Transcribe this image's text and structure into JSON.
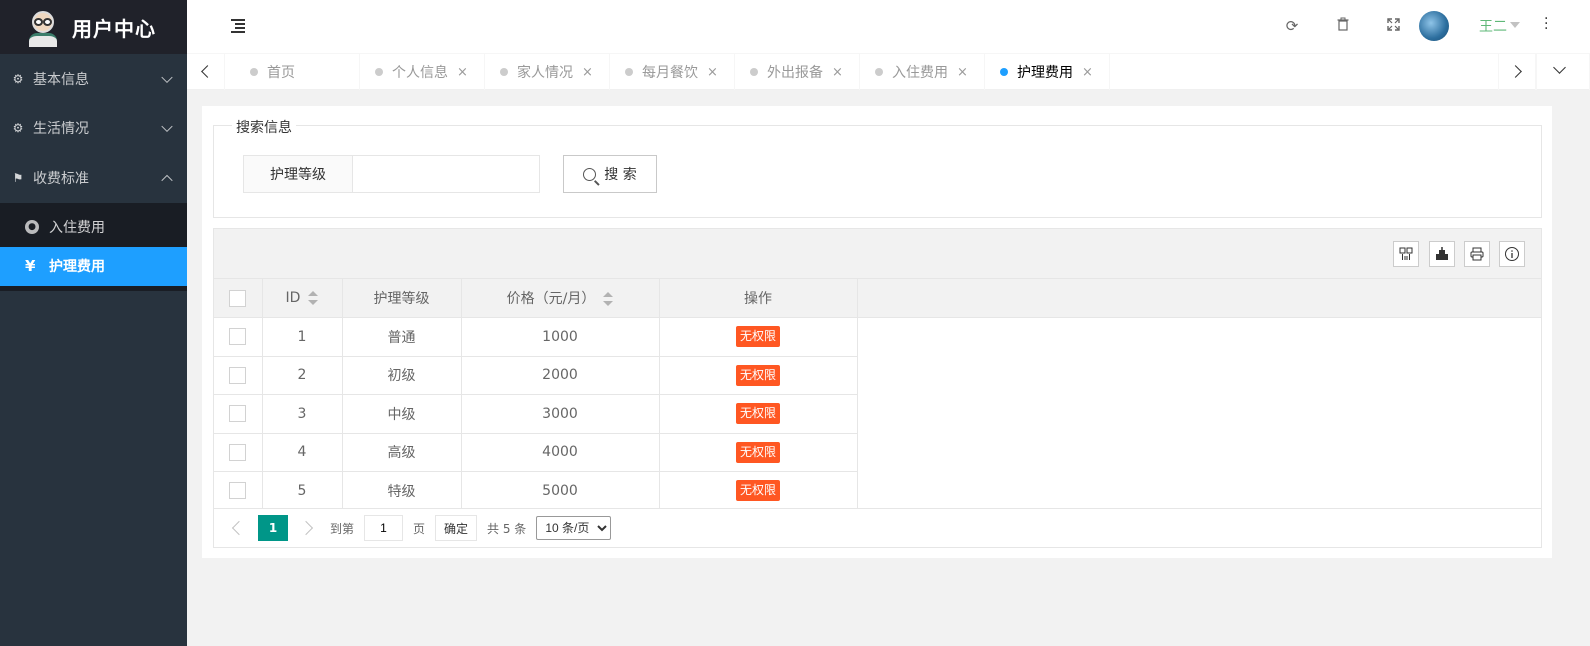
{
  "sidebar": {
    "title": "用户中心",
    "items": [
      {
        "label": "基本信息",
        "icon": "gears-icon"
      },
      {
        "label": "生活情况",
        "icon": "gears-icon"
      },
      {
        "label": "收费标准",
        "icon": "flag-icon"
      }
    ],
    "subitems": [
      {
        "label": "入住费用",
        "icon": "circle-icon"
      },
      {
        "label": "护理费用",
        "icon": "yen-icon",
        "glyph": "¥"
      }
    ]
  },
  "header": {
    "user_name": "王二",
    "icons": [
      "menu-toggle-icon",
      "refresh-icon",
      "trash-icon",
      "fullscreen-icon",
      "more-icon"
    ],
    "user_color": "#5fb878"
  },
  "tabs": [
    {
      "label": "首页"
    },
    {
      "label": "个人信息",
      "close": "×"
    },
    {
      "label": "家人情况",
      "close": "×"
    },
    {
      "label": "每月餐饮",
      "close": "×"
    },
    {
      "label": "外出报备",
      "close": "×"
    },
    {
      "label": "入住费用",
      "close": "×"
    },
    {
      "label": "护理费用",
      "close": "×"
    }
  ],
  "search": {
    "legend": "搜索信息",
    "field_label": "护理等级",
    "value": "",
    "placeholder": "",
    "button_label": "搜 索"
  },
  "table": {
    "columns": [
      "ID",
      "护理等级",
      "价格（元/月）",
      "操作"
    ],
    "rows": [
      {
        "id": "1",
        "level": "普通",
        "price": "1000",
        "action": "无权限"
      },
      {
        "id": "2",
        "level": "初级",
        "price": "2000",
        "action": "无权限"
      },
      {
        "id": "3",
        "level": "中级",
        "price": "3000",
        "action": "无权限"
      },
      {
        "id": "4",
        "level": "高级",
        "price": "4000",
        "action": "无权限"
      },
      {
        "id": "5",
        "level": "特级",
        "price": "5000",
        "action": "无权限"
      }
    ],
    "toolbar_icons": [
      "columns-icon",
      "export-icon",
      "print-icon",
      "info-icon"
    ]
  },
  "pager": {
    "current": "1",
    "goto_label": "到第",
    "goto_value": "1",
    "page_unit": "页",
    "confirm": "确定",
    "total": "共 5 条",
    "page_size": "10 条/页"
  },
  "colors": {
    "sidebar_bg": "#28333e",
    "active_blue": "#1e9fff",
    "badge_orange": "#ff5722",
    "pager_green": "#009688"
  }
}
